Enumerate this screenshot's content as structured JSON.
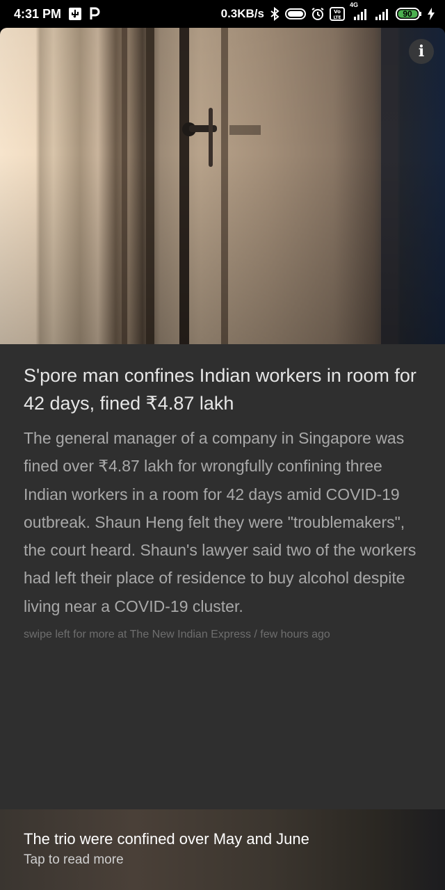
{
  "status_bar": {
    "time": "4:31 PM",
    "network_speed": "0.3KB/s",
    "network_type": "4G",
    "volte_label": "Vo LTE",
    "battery_level": "90",
    "icons": [
      "usb-icon",
      "paytm-icon",
      "bluetooth-icon",
      "toggle-icon",
      "alarm-icon",
      "volte-icon",
      "signal-icon",
      "signal-icon-2",
      "battery-icon",
      "charging-icon"
    ]
  },
  "card": {
    "info_icon": "i",
    "headline": "S'pore man confines Indian workers in room for 42 days, fined ₹4.87 lakh",
    "summary": "The general manager of a company in Singapore was fined over ₹4.87 lakh for wrongfully confining three Indian workers in a room for 42 days amid COVID-19 outbreak. Shaun Heng felt they were \"troublemakers\", the court heard. Shaun's lawyer said two of the workers had left their place of residence to buy alcohol despite living near a COVID-19 cluster.",
    "source": "swipe left for more at The New Indian Express / few hours ago"
  },
  "footer": {
    "title": "The trio were confined over May and June",
    "subtitle": "Tap to read more"
  }
}
